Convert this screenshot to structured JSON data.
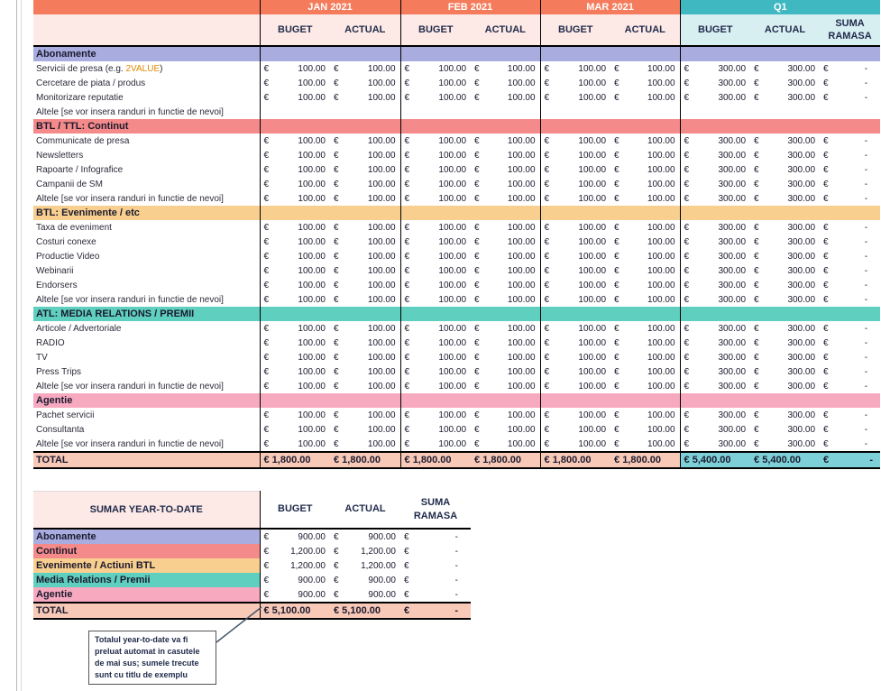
{
  "columns": {
    "months": [
      "JAN 2021",
      "FEB 2021",
      "MAR 2021"
    ],
    "quarter": "Q1",
    "buget": "BUGET",
    "actual": "ACTUAL",
    "suma1": "SUMA",
    "suma2": "RAMASA"
  },
  "currency": "€",
  "sections": [
    {
      "title": "Abonamente",
      "color": "#a9acdf",
      "rows": [
        {
          "label_pre": "Servicii de presa (e.g. ",
          "label_accent": "2VALUE",
          "label_post": ")",
          "filled": true
        },
        {
          "label": "Cercetare de piata / produs",
          "filled": true
        },
        {
          "label": "Monitorizare reputatie",
          "filled": true
        },
        {
          "label": "Altele [se vor insera randuri in functie de nevoi]",
          "filled": false
        }
      ]
    },
    {
      "title": "BTL / TTL: Continut",
      "color": "#f48a8a",
      "rows": [
        {
          "label": "Communicate de presa",
          "filled": true
        },
        {
          "label": "Newsletters",
          "filled": true
        },
        {
          "label": "Rapoarte / Infografice",
          "filled": true
        },
        {
          "label": "Campanii de SM",
          "filled": true
        },
        {
          "label": "Altele [se vor insera randuri in functie de nevoi]",
          "filled": true
        }
      ]
    },
    {
      "title": "BTL:  Evenimente / etc",
      "color": "#f9cf8f",
      "rows": [
        {
          "label": "Taxa de eveniment",
          "filled": true
        },
        {
          "label": "Costuri conexe",
          "filled": true
        },
        {
          "label": "Productie Video",
          "filled": true
        },
        {
          "label": "Webinarii",
          "filled": true
        },
        {
          "label": "Endorsers",
          "filled": true
        },
        {
          "label": "Altele [se vor insera randuri in functie de nevoi]",
          "filled": true
        }
      ]
    },
    {
      "title": "ATL: MEDIA RELATIONS / PREMII",
      "color": "#5fcfbf",
      "rows": [
        {
          "label": "Articole / Advertoriale",
          "filled": true
        },
        {
          "label": "RADIO",
          "filled": true
        },
        {
          "label": "TV",
          "filled": true
        },
        {
          "label": "Press Trips",
          "filled": true
        },
        {
          "label": "Altele [se vor insera randuri in functie de nevoi]",
          "filled": true
        }
      ]
    },
    {
      "title": "Agentie",
      "color": "#f7a9c0",
      "rows": [
        {
          "label": "Pachet servicii",
          "filled": true
        },
        {
          "label": "Consultanta",
          "filled": true
        },
        {
          "label": "Altele [se vor insera randuri in functie de nevoi]",
          "filled": true
        }
      ]
    }
  ],
  "row_values": {
    "month": "100.00",
    "quarter": "300.00",
    "remaining": "-"
  },
  "total": {
    "label": "TOTAL",
    "months": [
      "€ 1,800.00",
      "€ 1,800.00",
      "€ 1,800.00",
      "€ 1,800.00",
      "€ 1,800.00",
      "€ 1,800.00"
    ],
    "q_buget": "€ 5,400.00",
    "q_actual": "€ 5,400.00",
    "q_suma": "€",
    "q_dash": "-"
  },
  "summary": {
    "title": "SUMAR YEAR-TO-DATE",
    "h_buget": "BUGET",
    "h_actual": "ACTUAL",
    "h_suma1": "SUMA",
    "h_suma2": "RAMASA",
    "rows": [
      {
        "label": "Abonamente",
        "color": "#a9acdf",
        "buget": "900.00",
        "actual": "900.00"
      },
      {
        "label": "Continut",
        "color": "#f48a8a",
        "buget": "1,200.00",
        "actual": "1,200.00"
      },
      {
        "label": "Evenimente / Actiuni BTL",
        "color": "#f9cf8f",
        "buget": "1,200.00",
        "actual": "1,200.00"
      },
      {
        "label": "Media Relations / Premii",
        "color": "#5fcfbf",
        "buget": "900.00",
        "actual": "900.00"
      },
      {
        "label": "Agentie",
        "color": "#f7a9c0",
        "buget": "900.00",
        "actual": "900.00"
      }
    ],
    "remaining": "-",
    "total_label": "TOTAL",
    "total_buget": "€ 5,100.00",
    "total_actual": "€ 5,100.00",
    "total_suma": "€",
    "total_dash": "-"
  },
  "callout": "Totalul year-to-date va fi preluat automat in casutele de mai sus; sumele trecute sunt cu titlu de exemplu"
}
